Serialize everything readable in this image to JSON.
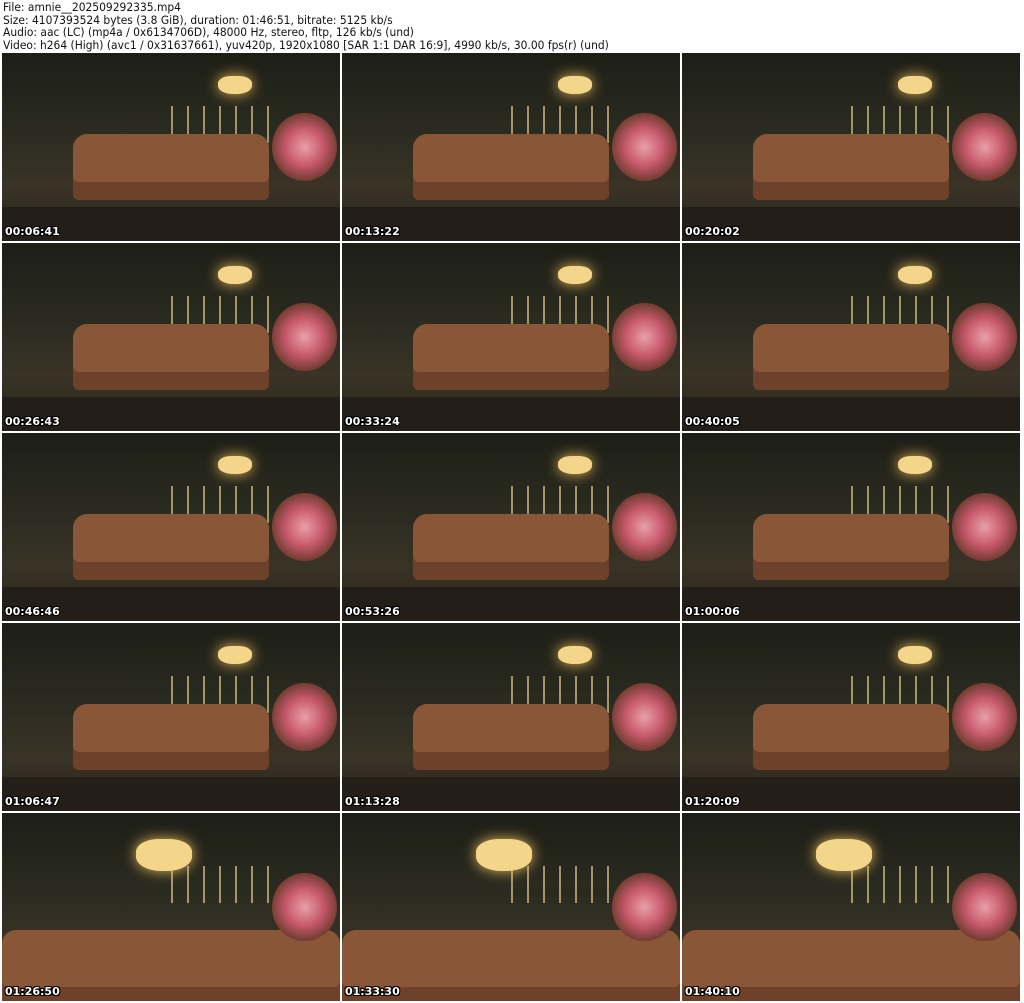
{
  "header": {
    "file": "File: amnie__202509292335.mp4",
    "size": "Size: 4107393524 bytes (3.8 GiB), duration: 01:46:51, bitrate: 5125 kb/s",
    "audio": "Audio: aac (LC) (mp4a / 0x6134706D), 48000 Hz, stereo, fltp, 126 kb/s (und)",
    "video": "Video: h264 (High) (avc1 / 0x31637661), yuv420p, 1920x1080 [SAR 1:1 DAR 16:9], 4990 kb/s, 30.00 fps(r) (und)"
  },
  "thumbnails": [
    {
      "timestamp": "00:06:41"
    },
    {
      "timestamp": "00:13:22"
    },
    {
      "timestamp": "00:20:02"
    },
    {
      "timestamp": "00:26:43"
    },
    {
      "timestamp": "00:33:24"
    },
    {
      "timestamp": "00:40:05"
    },
    {
      "timestamp": "00:46:46"
    },
    {
      "timestamp": "00:53:26"
    },
    {
      "timestamp": "01:00:06"
    },
    {
      "timestamp": "01:06:47"
    },
    {
      "timestamp": "01:13:28"
    },
    {
      "timestamp": "01:20:09"
    },
    {
      "timestamp": "01:26:50"
    },
    {
      "timestamp": "01:33:30"
    },
    {
      "timestamp": "01:40:10"
    }
  ]
}
